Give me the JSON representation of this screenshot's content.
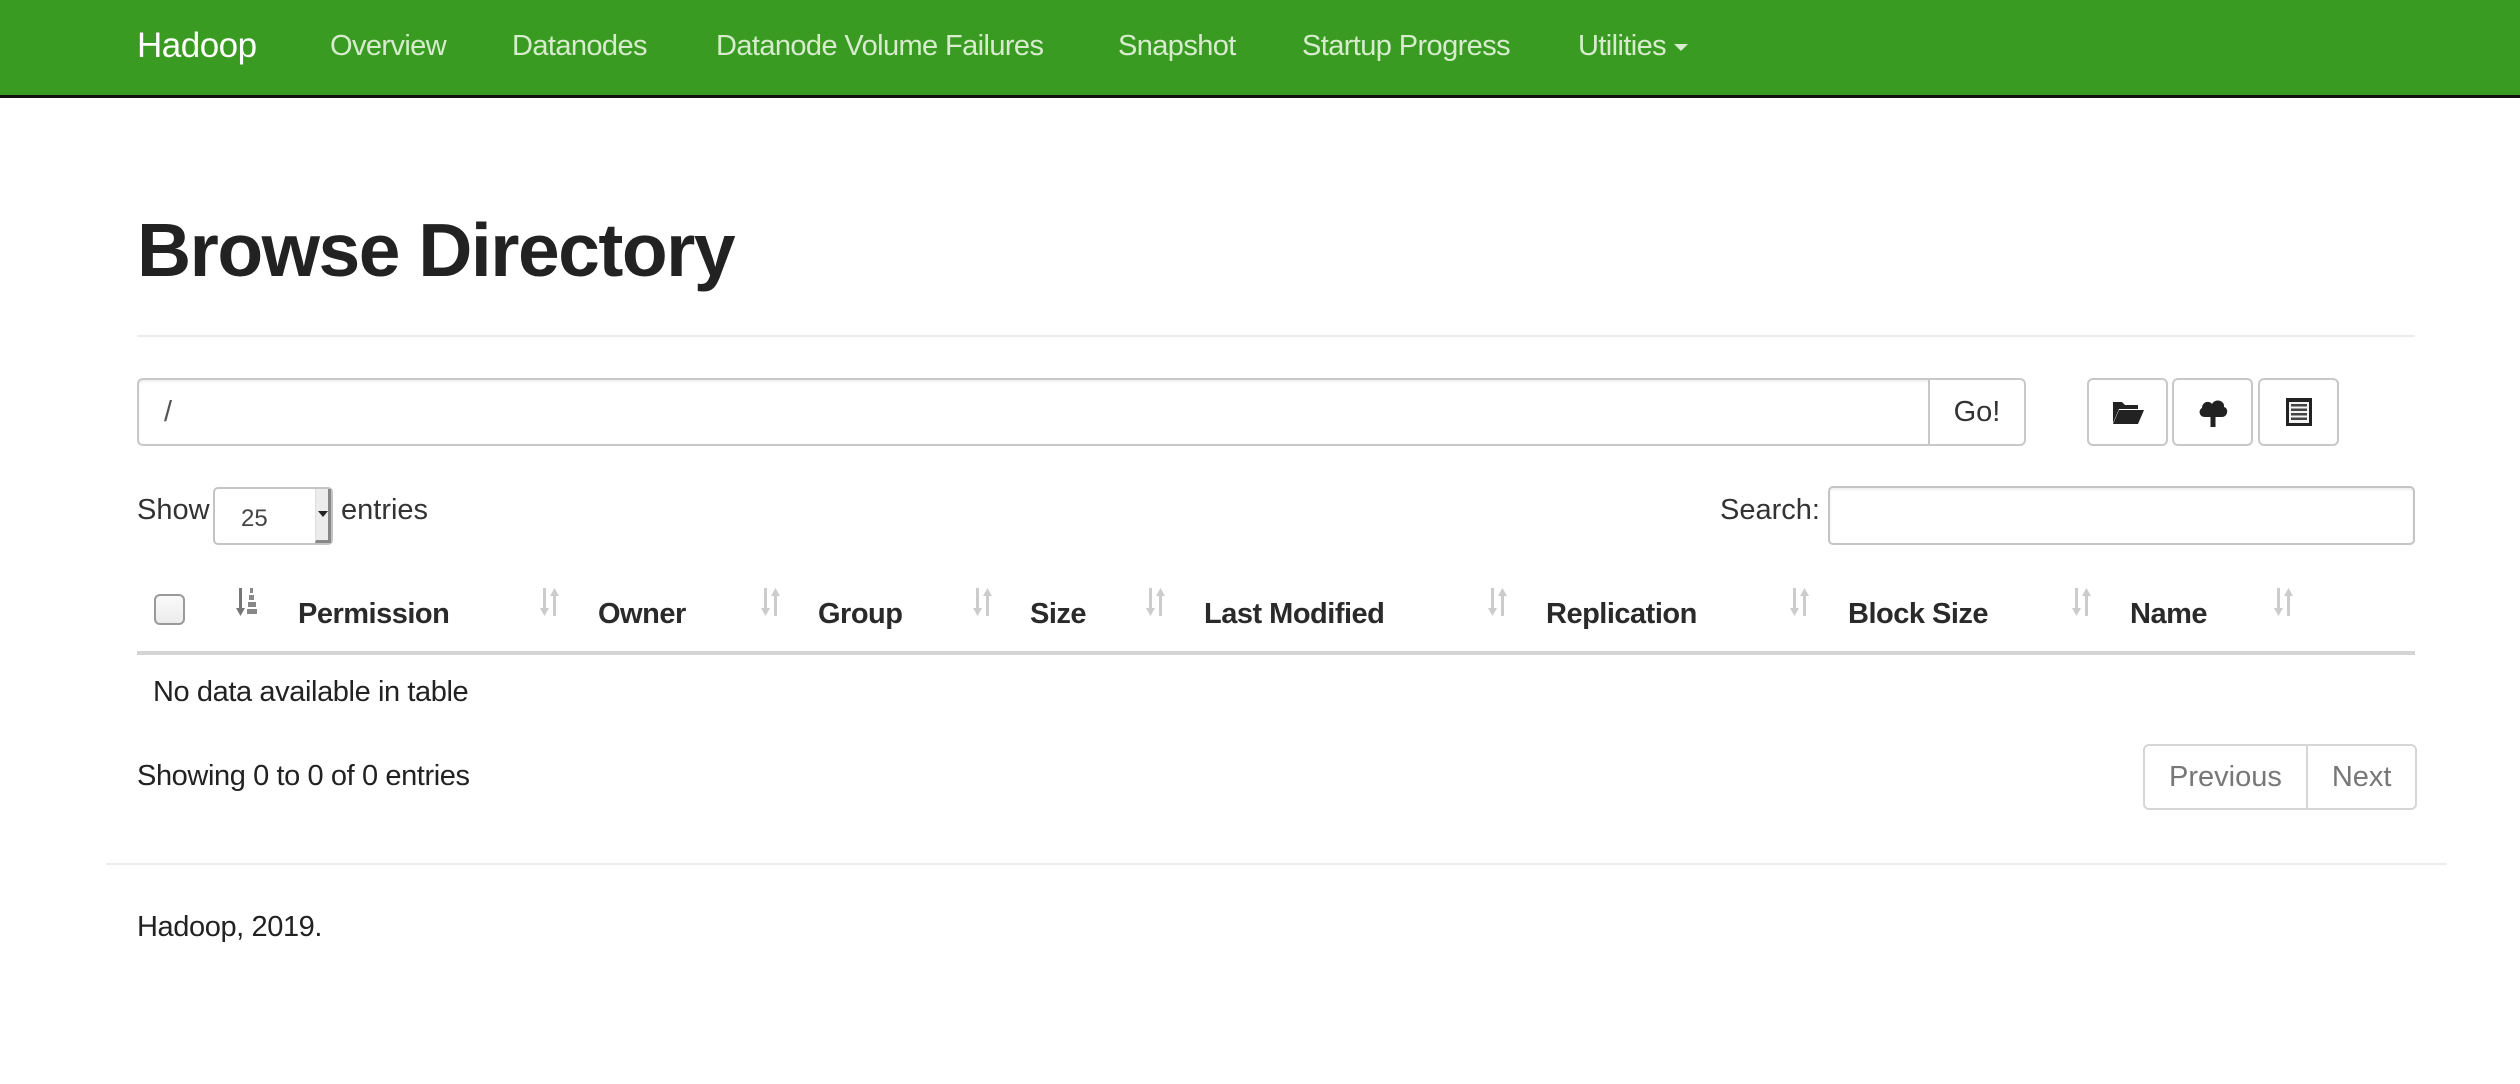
{
  "navbar": {
    "brand": "Hadoop",
    "items": [
      {
        "label": "Overview"
      },
      {
        "label": "Datanodes"
      },
      {
        "label": "Datanode Volume Failures"
      },
      {
        "label": "Snapshot"
      },
      {
        "label": "Startup Progress"
      },
      {
        "label": "Utilities",
        "has_dropdown": true
      }
    ],
    "color": "#3a9b22"
  },
  "page": {
    "title": "Browse Directory"
  },
  "path_bar": {
    "value": "/",
    "go_label": "Go!",
    "actions": [
      {
        "icon": "folder-open-icon",
        "name": "create-directory-button"
      },
      {
        "icon": "cloud-upload-icon",
        "name": "upload-files-button"
      },
      {
        "icon": "list-alt-icon",
        "name": "cut-paste-button"
      }
    ]
  },
  "table_controls": {
    "show_label": "Show",
    "entries_label": "entries",
    "page_length": "25",
    "search_label": "Search:",
    "search_value": ""
  },
  "table": {
    "columns": [
      {
        "label": "Permission"
      },
      {
        "label": "Owner"
      },
      {
        "label": "Group"
      },
      {
        "label": "Size"
      },
      {
        "label": "Last Modified"
      },
      {
        "label": "Replication"
      },
      {
        "label": "Block Size"
      },
      {
        "label": "Name"
      }
    ],
    "rows": [],
    "empty_message": "No data available in table"
  },
  "pagination": {
    "info": "Showing 0 to 0 of 0 entries",
    "previous_label": "Previous",
    "next_label": "Next"
  },
  "footer": {
    "text": "Hadoop, 2019."
  }
}
